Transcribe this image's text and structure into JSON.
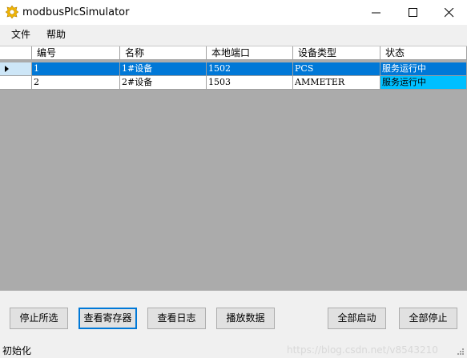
{
  "window": {
    "title": "modbusPlcSimulator",
    "icon": "gear-icon",
    "controls": [
      "minimize-icon",
      "maximize-icon",
      "close-icon"
    ]
  },
  "menu": {
    "file": "文件",
    "help": "帮助"
  },
  "grid": {
    "columns": [
      "编号",
      "名称",
      "本地端口",
      "设备类型",
      "状态"
    ],
    "rows": [
      {
        "id": "1",
        "name": "1#设备",
        "port": "1502",
        "type": "PCS",
        "status": "服务运行中",
        "selected": true
      },
      {
        "id": "2",
        "name": "2#设备",
        "port": "1503",
        "type": "AMMETER",
        "status": "服务运行中",
        "selected": false
      }
    ]
  },
  "buttons": {
    "stop_selected": "停止所选",
    "view_registers": "查看寄存器",
    "view_log": "查看日志",
    "play_data": "播放数据",
    "start_all": "全部启动",
    "stop_all": "全部停止"
  },
  "statusbar": {
    "text": "初始化",
    "watermark": "https://blog.csdn.net/v8543210"
  },
  "colors": {
    "selection": "#0078d7",
    "status_highlight": "#00bfff",
    "grid_background": "#ababab"
  }
}
